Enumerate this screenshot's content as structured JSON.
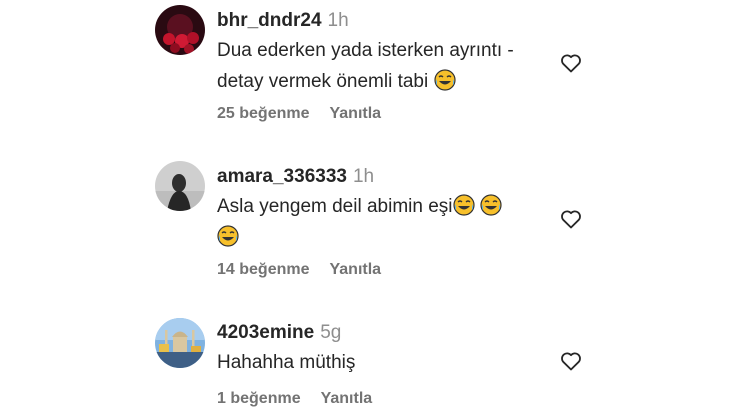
{
  "comments": [
    {
      "username": "bhr_dndr24",
      "time": "1h",
      "text_line1": "Dua ederken yada isterken ayrıntı -",
      "text_line2": "detay vermek önemli tabi",
      "likes": "25 beğenme",
      "reply": "Yanıtla"
    },
    {
      "username": "amara_336333",
      "time": "1h",
      "text_line1": "Asla yengem deil abimin eşi",
      "likes": "14 beğenme",
      "reply": "Yanıtla"
    },
    {
      "username": "4203emine",
      "time": "5g",
      "text_line1": "Hahahha müthiş",
      "likes": "1 beğenme",
      "reply": "Yanıtla"
    }
  ],
  "colors": {
    "text": "#262626",
    "secondary": "#737373",
    "time": "#8e8e8e",
    "emoji_face": "#f7c02b"
  },
  "icons": {
    "like": "heart-outline-icon",
    "emoji": "laughing-tears-emoji"
  }
}
